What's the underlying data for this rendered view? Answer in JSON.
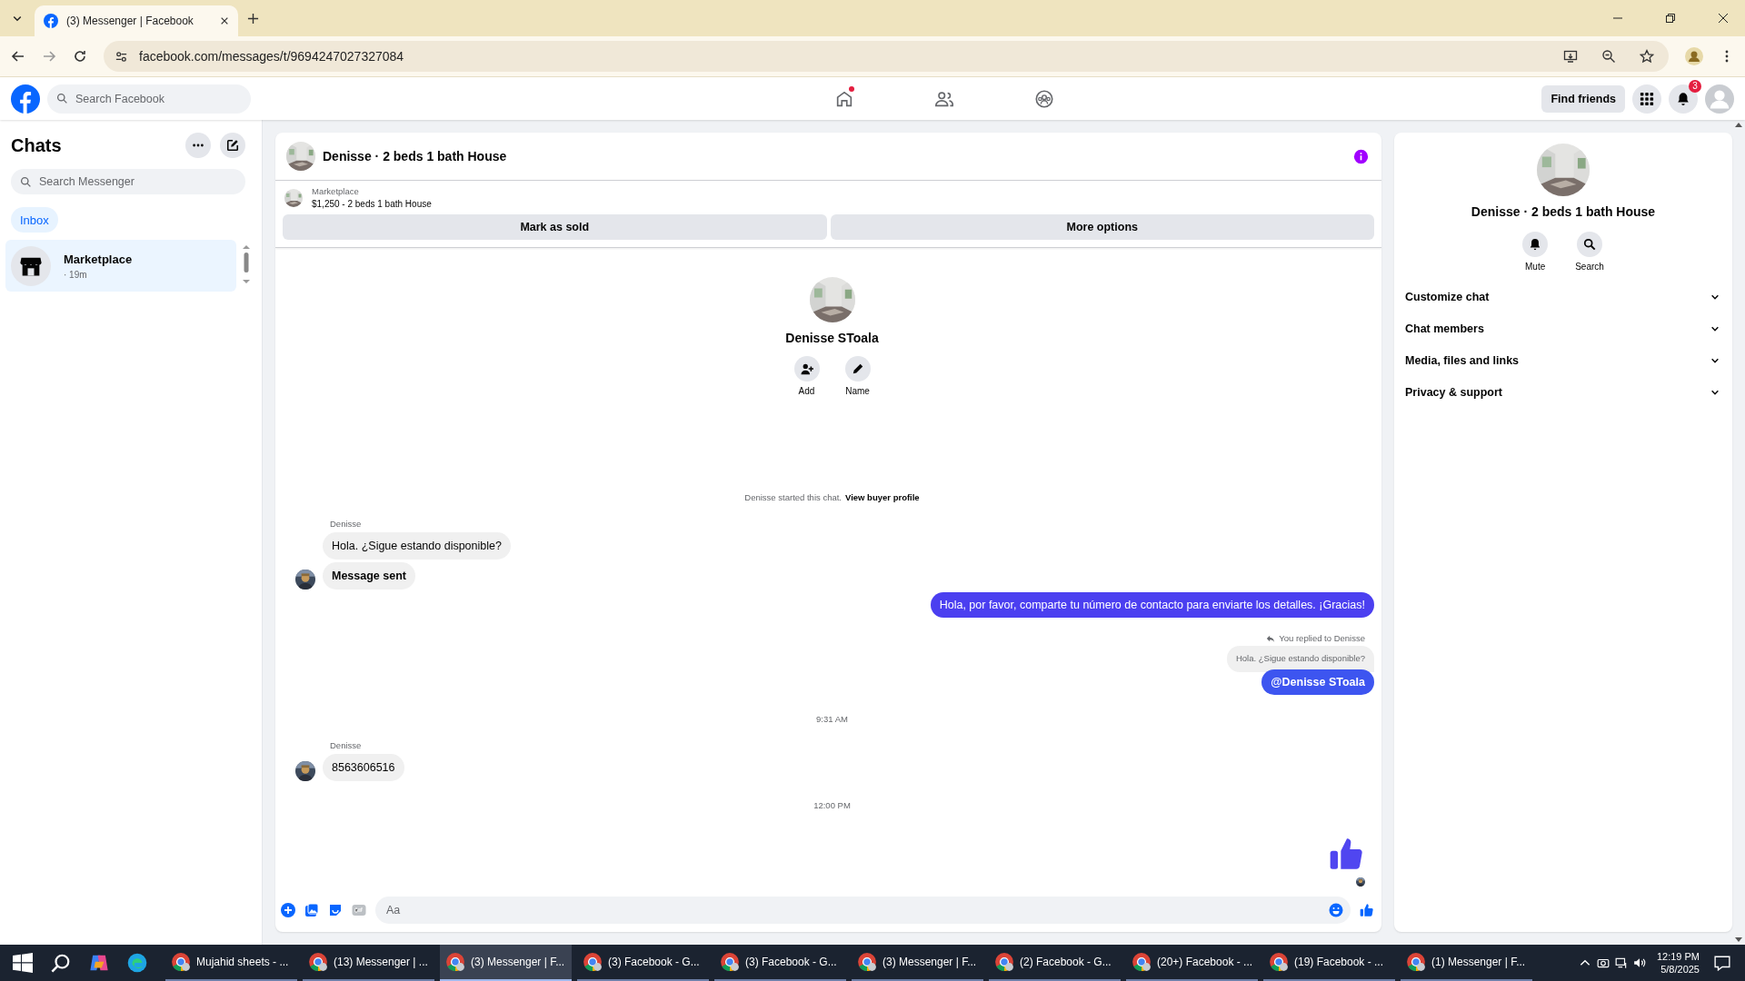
{
  "browser": {
    "tab": {
      "title": "(3) Messenger | Facebook"
    },
    "url": "facebook.com/messages/t/9694247027327084"
  },
  "topbar": {
    "search_placeholder": "Search Facebook",
    "home_dot": true,
    "find_friends": "Find friends",
    "notification_count": "3"
  },
  "sidebar": {
    "title": "Chats",
    "search_placeholder": "Search Messenger",
    "filters": [
      {
        "label": "Inbox",
        "selected": true
      }
    ],
    "conversations": [
      {
        "name": "Marketplace",
        "time": "· 19m",
        "selected": true
      }
    ]
  },
  "chat": {
    "title": "Denisse · 2 beds 1 bath House",
    "listing": {
      "source": "Marketplace",
      "title": "$1,250 - 2 beds 1 bath House"
    },
    "actions": [
      "Mark as sold",
      "More options"
    ],
    "profile": {
      "name": "Denisse SToala",
      "actions": [
        {
          "kind": "add",
          "label": "Add"
        },
        {
          "kind": "name",
          "label": "Name"
        }
      ]
    },
    "messages": [
      {
        "kind": "notice",
        "text": "Denisse started this chat.",
        "link": "View buyer profile"
      },
      {
        "kind": "sender",
        "text": "Denisse"
      },
      {
        "kind": "incoming",
        "text": "Hola. ¿Sigue estando disponible?",
        "avatar": false,
        "bold": false
      },
      {
        "kind": "incoming",
        "text": "Message sent",
        "avatar": true,
        "bold": true
      },
      {
        "kind": "outgoing",
        "text": "Hola, por favor, comparte tu número de contacto para enviarte los detalles. ¡Gracias!",
        "bold": false
      },
      {
        "kind": "reply_note",
        "text": "You replied to Denisse"
      },
      {
        "kind": "quoted",
        "text": "Hola. ¿Sigue estando disponible?"
      },
      {
        "kind": "outgoing",
        "text": "@Denisse SToala",
        "bold": true
      },
      {
        "kind": "time",
        "text": "9:31 AM"
      },
      {
        "kind": "sender",
        "text": "Denisse"
      },
      {
        "kind": "incoming",
        "text": "8563606516",
        "avatar": true,
        "bold": false
      },
      {
        "kind": "time",
        "text": "12:00 PM"
      },
      {
        "kind": "like"
      }
    ],
    "composer_placeholder": "Aa"
  },
  "details": {
    "title": "Denisse · 2 beds 1 bath House",
    "actions": [
      {
        "kind": "mute",
        "label": "Mute"
      },
      {
        "kind": "search",
        "label": "Search"
      }
    ],
    "sections": [
      {
        "label": "Customize chat",
        "expanded": false
      },
      {
        "label": "Chat members",
        "expanded": false
      },
      {
        "label": "Media, files and links",
        "expanded": false
      },
      {
        "label": "Privacy & support",
        "expanded": false
      }
    ]
  },
  "taskbar": {
    "items": [
      {
        "label": "Mujahid sheets - ...",
        "selected": false
      },
      {
        "label": "(13) Messenger | ...",
        "selected": false
      },
      {
        "label": "(3) Messenger | F...",
        "selected": true
      },
      {
        "label": "(3) Facebook - G...",
        "selected": false
      },
      {
        "label": "(3) Facebook - G...",
        "selected": false
      },
      {
        "label": "(3) Messenger | F...",
        "selected": false
      },
      {
        "label": "(2) Facebook - G...",
        "selected": false
      },
      {
        "label": "(20+) Facebook - ...",
        "selected": false
      },
      {
        "label": "(19) Facebook - ...",
        "selected": false
      },
      {
        "label": "(1) Messenger | F...",
        "selected": false
      }
    ],
    "time": "12:19 PM",
    "date": "5/8/2025"
  }
}
